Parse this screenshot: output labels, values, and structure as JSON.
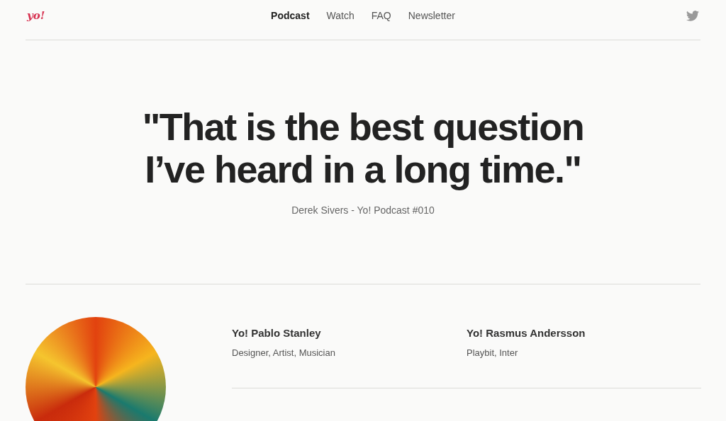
{
  "header": {
    "logo": "yo!",
    "nav": [
      {
        "label": "Podcast",
        "selected": true
      },
      {
        "label": "Watch",
        "selected": false
      },
      {
        "label": "FAQ",
        "selected": false
      },
      {
        "label": "Newsletter",
        "selected": false
      }
    ]
  },
  "quote": {
    "text": "\"That is the best question I’ve heard in a long time.\"",
    "attribution": "Derek Sivers - Yo! Podcast #010"
  },
  "hosts": [
    {
      "name": "Yo! Pablo Stanley",
      "roles": "Designer, Artist, Musician"
    },
    {
      "name": "Yo! Rasmus Andersson",
      "roles": "Playbit, Inter"
    }
  ]
}
